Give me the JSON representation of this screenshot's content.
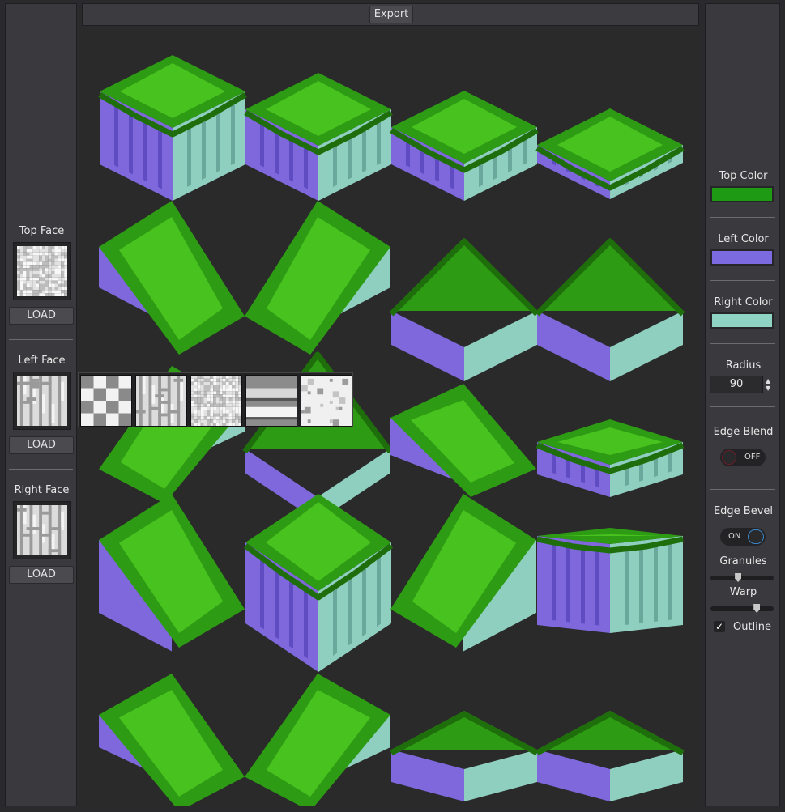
{
  "toolbar": {
    "export_label": "Export"
  },
  "left_panel": {
    "sections": [
      {
        "label": "Top Face",
        "button": "LOAD",
        "texture": "noise"
      },
      {
        "label": "Left Face",
        "button": "LOAD",
        "texture": "maze"
      },
      {
        "label": "Right Face",
        "button": "LOAD",
        "texture": "maze"
      }
    ]
  },
  "right_panel": {
    "top_color": {
      "label": "Top Color",
      "value": "#1f9a14"
    },
    "left_color": {
      "label": "Left Color",
      "value": "#7b6ae0"
    },
    "right_color": {
      "label": "Right Color",
      "value": "#8fd3c4"
    },
    "radius": {
      "label": "Radius",
      "value": "90"
    },
    "edge_blend": {
      "label": "Edge Blend",
      "state": "OFF"
    },
    "edge_bevel": {
      "label": "Edge Bevel",
      "state": "ON"
    },
    "granules": {
      "label": "Granules",
      "value": 0.43
    },
    "warp": {
      "label": "Warp",
      "value": 0.76
    },
    "outline": {
      "label": "Outline",
      "checked": true,
      "check_glyph": "✓"
    }
  },
  "texture_popup": {
    "options": [
      "checker-icon",
      "maze-icon",
      "noise-icon",
      "stripes-icon",
      "stones-icon"
    ]
  },
  "colors": {
    "grass_top": "#2e9b14",
    "grass_dark": "#1f6e0c",
    "grass_light": "#48c21e",
    "left_face": "#7e68dc",
    "left_face_dark": "#5f4bc2",
    "right_face": "#8fcfc0",
    "right_face_dark": "#6aa89c"
  }
}
